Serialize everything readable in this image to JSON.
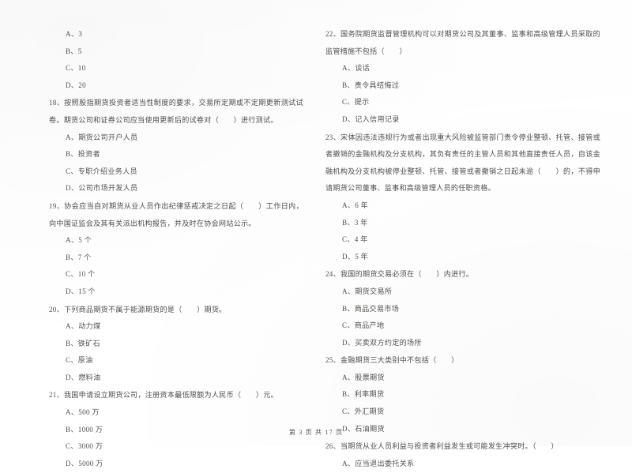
{
  "document": {
    "type": "exam-paper-scan",
    "footer": "第 3 页 共 17 页"
  },
  "left_column": {
    "orphan_options": [
      "A、3",
      "B、5",
      "C、10",
      "D、20"
    ],
    "questions": [
      {
        "number": "18",
        "stem": "18、按照股指期货投资者适当性制度的要求，交易所定期或不定期更新测试试卷。期货公司和证券公司应当使用更新后的试卷对（　　）进行测试。",
        "options": [
          "A、期货公司开户人员",
          "B、投资者",
          "C、专职介绍业务人员",
          "D、公司市场开发人员"
        ]
      },
      {
        "number": "19",
        "stem": "19、协会应当自对期货从业人员作出纪律惩戒决定之日起（　　）工作日内，向中国证监会及其有关派出机构报告，并及时在协会网站公示。",
        "options": [
          "A、5 个",
          "B、7 个",
          "C、10 个",
          "D、15 个"
        ]
      },
      {
        "number": "20",
        "stem": "20、下列商品期货不属于能源期货的是（　　）期货。",
        "options": [
          "A、动力煤",
          "B、铁矿石",
          "C、原油",
          "D、燃料油"
        ]
      },
      {
        "number": "21",
        "stem": "21、我国申请设立期货公司，注册资本最低限额为人民币（　　）元。",
        "options": [
          "A、500 万",
          "B、1000 万",
          "C、3000 万",
          "D、5000 万"
        ]
      }
    ]
  },
  "right_column": {
    "questions": [
      {
        "number": "22",
        "stem": "22、国务院期货监督管理机构可以对期货公司及其董事、监事和高级管理人员采取的监管措施不包括（　　）",
        "options": [
          "A、谈话",
          "B、责令具结悔过",
          "C、提示",
          "D、记入信用记录"
        ]
      },
      {
        "number": "23",
        "stem": "23、宋体因违法违规行为或者出现重大风险被监管部门责令停业整顿、托管、接管或者撤销的金融机构及分支机构，其负有责任的主管人员和其他直接责任人员，自该金融机构及分支机构被停业整顿、托管、接管或者撤销之日起未逾（　　）的，不得申请期货公司董事、监事和高级管理人员的任职资格。",
        "options": [
          "A、6 年",
          "B、3 年",
          "C、4 年",
          "D、5 年"
        ]
      },
      {
        "number": "24",
        "stem": "24、我国的期货交易必须在（　　）内进行。",
        "options": [
          "A、期货交易所",
          "B、商品交易市场",
          "C、商品产地",
          "D、买卖双方约定的场所"
        ]
      },
      {
        "number": "25",
        "stem": "25、金融期货三大类别中不包括（　　）",
        "options": [
          "A、股票期货",
          "B、利率期货",
          "C、外汇期货",
          "D、石油期货"
        ]
      },
      {
        "number": "26",
        "stem": "26、当期货从业人员利益与投资者利益发生或可能发生冲突时。（　　）",
        "options": [
          "A、应当退出委托关系"
        ]
      }
    ]
  }
}
